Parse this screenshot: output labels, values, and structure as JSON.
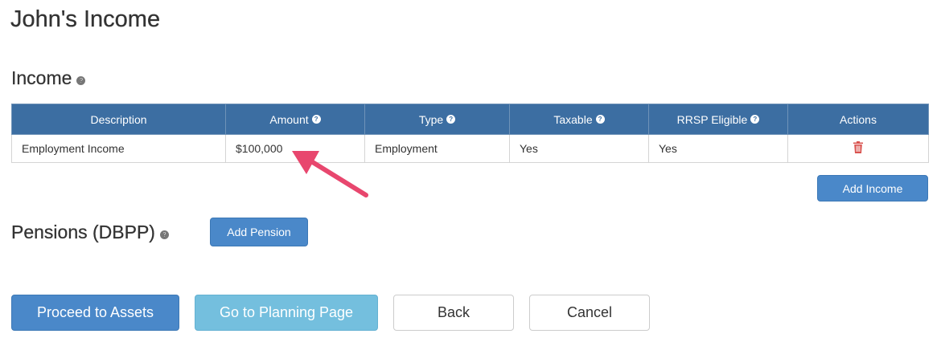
{
  "page": {
    "title": "John's Income"
  },
  "income": {
    "title": "Income",
    "help": "?",
    "columns": [
      {
        "label": "Description",
        "help": ""
      },
      {
        "label": "Amount",
        "help": "?"
      },
      {
        "label": "Type",
        "help": "?"
      },
      {
        "label": "Taxable",
        "help": "?"
      },
      {
        "label": "RRSP Eligible",
        "help": "?"
      },
      {
        "label": "Actions",
        "help": ""
      }
    ],
    "rows": [
      {
        "description": "Employment Income",
        "amount": "$100,000",
        "type": "Employment",
        "taxable": "Yes",
        "rrsp_eligible": "Yes",
        "actions_icon": "trash-icon"
      }
    ],
    "add_button": "Add Income"
  },
  "pensions": {
    "title": "Pensions (DBPP)",
    "help": "?",
    "add_button": "Add Pension"
  },
  "footer": {
    "proceed": "Proceed to Assets",
    "planning": "Go to Planning Page",
    "back": "Back",
    "cancel": "Cancel"
  },
  "annotation": {
    "icon": "pointer-arrow-icon",
    "color": "#e8476e"
  },
  "colors": {
    "table_header": "#3c6ea2",
    "primary_button": "#4a88c9",
    "info_button": "#74bfde",
    "delete_icon": "#d9534f"
  }
}
